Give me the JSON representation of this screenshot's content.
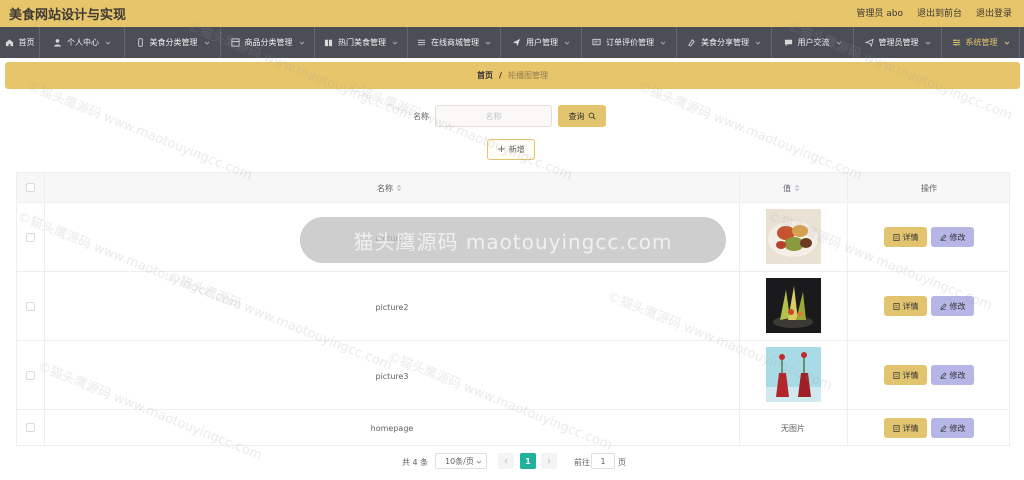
{
  "header": {
    "title": "美食网站设计与实现",
    "admin_label": "管理员 abo",
    "front_link": "退出到前台",
    "logout_link": "退出登录"
  },
  "nav": {
    "items": [
      {
        "label": "首页",
        "icon": "home-icon"
      },
      {
        "label": "个人中心",
        "icon": "user-icon"
      },
      {
        "label": "美食分类管理",
        "icon": "phone-icon"
      },
      {
        "label": "商品分类管理",
        "icon": "grid-icon"
      },
      {
        "label": "热门美食管理",
        "icon": "book-icon"
      },
      {
        "label": "在线商城管理",
        "icon": "list-icon"
      },
      {
        "label": "用户管理",
        "icon": "send-icon"
      },
      {
        "label": "订单评价管理",
        "icon": "message-icon"
      },
      {
        "label": "美食分享管理",
        "icon": "share-icon"
      },
      {
        "label": "用户交流",
        "icon": "chat-icon"
      },
      {
        "label": "管理员管理",
        "icon": "plane-icon"
      },
      {
        "label": "系统管理",
        "icon": "settings-icon",
        "active": true
      }
    ]
  },
  "breadcrumb": {
    "home": "首页",
    "separator": "/",
    "current": "轮播图管理"
  },
  "search": {
    "label": "名称",
    "placeholder": "名称",
    "button": "查询"
  },
  "toolbar": {
    "add_label": "新增"
  },
  "table": {
    "headers": {
      "name": "名称",
      "value": "值",
      "actions": "操作"
    },
    "rows": [
      {
        "name": "picture1",
        "value_type": "image",
        "image": "food-image-1"
      },
      {
        "name": "picture2",
        "value_type": "image",
        "image": "food-image-2"
      },
      {
        "name": "picture3",
        "value_type": "image",
        "image": "food-image-3"
      },
      {
        "name": "homepage",
        "value_type": "text",
        "value": "无图片"
      }
    ],
    "detail_label": "详情",
    "edit_label": "修改"
  },
  "pagination": {
    "total": "共 4 条",
    "page_size": "10条/页",
    "current_page": "1",
    "goto_label": "前往",
    "goto_value": "1",
    "goto_unit": "页"
  },
  "watermark": {
    "text": "©猫头鹰源码 www.maotouyingcc.com",
    "banner": "猫头鹰源码 maotouyingcc.com"
  },
  "colors": {
    "accent": "#e7c56b",
    "nav_bg": "#4b4e57",
    "page_active": "#1fb19a",
    "edit_button": "#b5b6e6"
  }
}
